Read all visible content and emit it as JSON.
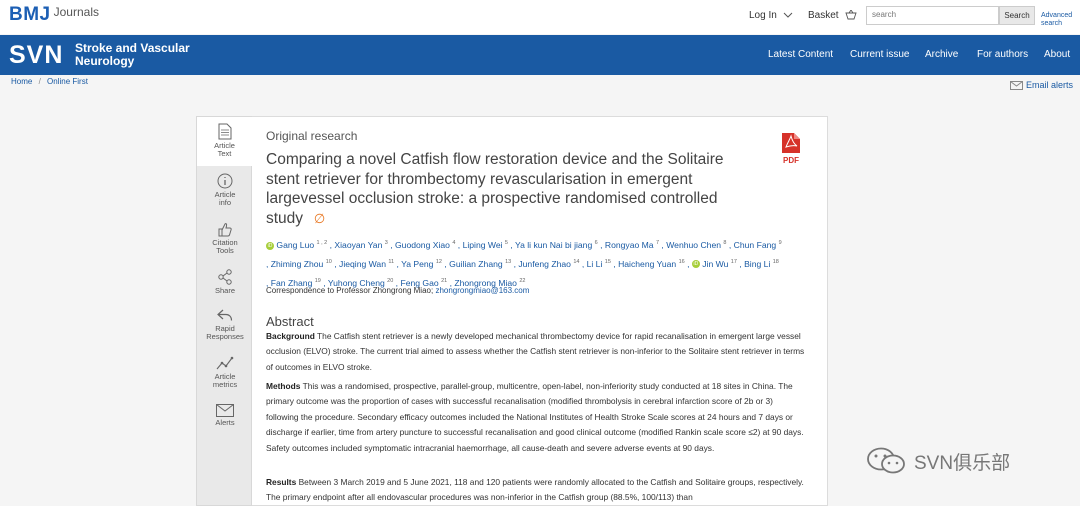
{
  "header": {
    "brand": "BMJ",
    "brand_sub": "Journals",
    "login": "Log In",
    "basket": "Basket",
    "search_placeholder": "search",
    "search_button": "Search",
    "advanced_line1": "Advanced",
    "advanced_line2": "search"
  },
  "nav": {
    "abbr": "SVN",
    "journal_line1": "Stroke and Vascular",
    "journal_line2": "Neurology",
    "links": [
      "Latest Content",
      "Current issue",
      "Archive",
      "For authors",
      "About"
    ]
  },
  "breadcrumb": {
    "home": "Home",
    "sep": "/",
    "current": "Online First"
  },
  "email_alerts": "Email alerts",
  "sidebar": {
    "items": [
      {
        "line1": "Article",
        "line2": "Text",
        "icon": "document-icon"
      },
      {
        "line1": "Article",
        "line2": "info",
        "icon": "info-icon"
      },
      {
        "line1": "Citation",
        "line2": "Tools",
        "icon": "citation-icon"
      },
      {
        "line1": "Share",
        "line2": "",
        "icon": "share-icon"
      },
      {
        "line1": "Rapid",
        "line2": "Responses",
        "icon": "reply-icon"
      },
      {
        "line1": "Article",
        "line2": "metrics",
        "icon": "metrics-icon"
      },
      {
        "line1": "Alerts",
        "line2": "",
        "icon": "envelope-icon"
      }
    ]
  },
  "article": {
    "kind": "Original research",
    "title": "Comparing a novel Catfish flow restoration device and the Solitaire stent retriever for thrombectomy revascularisation in emergent largevessel occlusion stroke: a prospective randomised controlled study",
    "pdf_label": "PDF",
    "authors": [
      {
        "name": "Gang Luo",
        "sup": "1 , 2",
        "orcid": true
      },
      {
        "name": "Xiaoyan Yan",
        "sup": "3"
      },
      {
        "name": "Guodong Xiao",
        "sup": "4"
      },
      {
        "name": "Liping Wei",
        "sup": "5"
      },
      {
        "name": "Ya li kun Nai bi jiang",
        "sup": "6"
      },
      {
        "name": "Rongyao Ma",
        "sup": "7"
      },
      {
        "name": "Wenhuo Chen",
        "sup": "8"
      },
      {
        "name": "Chun Fang",
        "sup": "9"
      },
      {
        "name": "Zhiming Zhou",
        "sup": "10"
      },
      {
        "name": "Jieqing Wan",
        "sup": "11"
      },
      {
        "name": "Ya Peng",
        "sup": "12"
      },
      {
        "name": "Guilian Zhang",
        "sup": "13"
      },
      {
        "name": "Junfeng Zhao",
        "sup": "14"
      },
      {
        "name": "Li Li",
        "sup": "15"
      },
      {
        "name": "Haicheng Yuan",
        "sup": "16"
      },
      {
        "name": "Jin Wu",
        "sup": "17",
        "orcid": true
      },
      {
        "name": "Bing Li",
        "sup": "18"
      },
      {
        "name": "Fan Zhang",
        "sup": "19"
      },
      {
        "name": "Yuhong Cheng",
        "sup": "20"
      },
      {
        "name": "Feng Gao",
        "sup": "21"
      },
      {
        "name": "Zhongrong Miao",
        "sup": "22"
      }
    ],
    "correspondence_label": "Correspondence to Professor Zhongrong Miao;",
    "correspondence_email": "zhongrongmiao@163.com",
    "abstract_heading": "Abstract",
    "background_label": "Background",
    "background_text": " The Catfish stent retriever is a newly developed mechanical thrombectomy device for rapid recanalisation in emergent large vessel occlusion (ELVO) stroke. The current trial aimed to assess whether the Catfish stent retriever is non-inferior to the Solitaire stent retriever in terms of outcomes in ELVO stroke.",
    "methods_label": "Methods",
    "methods_text": " This was a randomised, prospective, parallel-group, multicentre, open-label, non-inferiority study conducted at 18 sites in China. The primary outcome was the proportion of cases with successful recanalisation (modified thrombolysis in cerebral infarction score of 2b or 3) following the procedure. Secondary efficacy outcomes included the National Institutes of Health Stroke Scale scores at 24 hours and 7 days or discharge if earlier, time from artery puncture to successful recanalisation and good clinical outcome (modified Rankin scale score ≤2) at 90 days. Safety outcomes included symptomatic intracranial haemorrhage, all cause-death and severe adverse events at 90 days.",
    "results_label": "Results",
    "results_text": " Between 3 March 2019 and 5 June 2021, 118 and 120 patients were randomly allocated to the Catfish and Solitaire groups, respectively. The primary endpoint after all endovascular procedures was non-inferior in the Catfish group (88.5%, 100/113) than"
  },
  "watermark": "SVN俱乐部"
}
